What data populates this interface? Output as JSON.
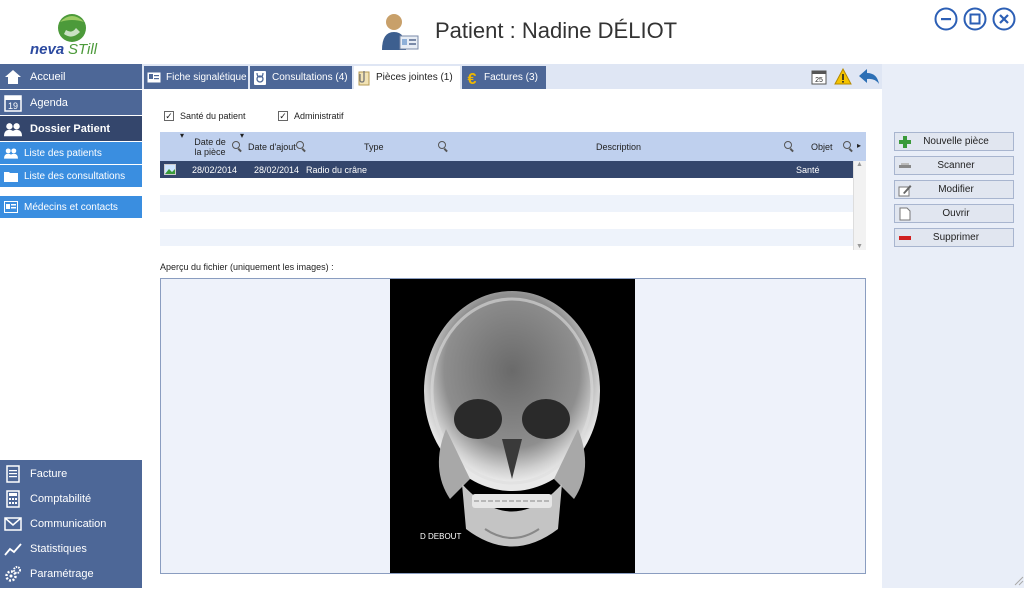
{
  "app": {
    "logo_text": "nevaSTill"
  },
  "header": {
    "title": "Patient : Nadine DÉLIOT"
  },
  "sidebar": {
    "items": [
      {
        "label": "Accueil"
      },
      {
        "label": "Agenda",
        "badge": "19"
      },
      {
        "label": "Dossier Patient"
      }
    ],
    "sub_items": [
      {
        "label": "Liste des patients"
      },
      {
        "label": "Liste des consultations"
      },
      {
        "label": "Médecins et contacts"
      }
    ],
    "bottom_items": [
      {
        "label": "Facture"
      },
      {
        "label": "Comptabilité"
      },
      {
        "label": "Communication"
      },
      {
        "label": "Statistiques"
      },
      {
        "label": "Paramétrage"
      }
    ]
  },
  "tabs": [
    {
      "label": "Fiche signalétique"
    },
    {
      "label": "Consultations (4)"
    },
    {
      "label": "Pièces jointes (1)"
    },
    {
      "label": "Factures (3)"
    }
  ],
  "toolbar": {
    "calendar_badge": "25"
  },
  "filters": {
    "sante": {
      "label": "Santé du patient",
      "checked": true
    },
    "admin": {
      "label": "Administratif",
      "checked": true
    }
  },
  "table": {
    "columns": [
      "Date de la pièce",
      "Date d'ajout",
      "Type",
      "Description",
      "Objet"
    ],
    "rows": [
      {
        "date_piece": "28/02/2014",
        "date_ajout": "28/02/2014",
        "type": "Radio du crâne",
        "description": "",
        "objet": "Santé"
      }
    ]
  },
  "preview": {
    "label": "Aperçu du fichier (uniquement les images) :",
    "image_caption": "D DEBOUT"
  },
  "actions": [
    {
      "label": "Nouvelle pièce"
    },
    {
      "label": "Scanner"
    },
    {
      "label": "Modifier"
    },
    {
      "label": "Ouvrir"
    },
    {
      "label": "Supprimer"
    }
  ],
  "colors": {
    "nav": "#4d6797",
    "nav_dark": "#34466c",
    "nav_sub": "#3a8ee0",
    "window_buttons": "#2c5fb5"
  }
}
